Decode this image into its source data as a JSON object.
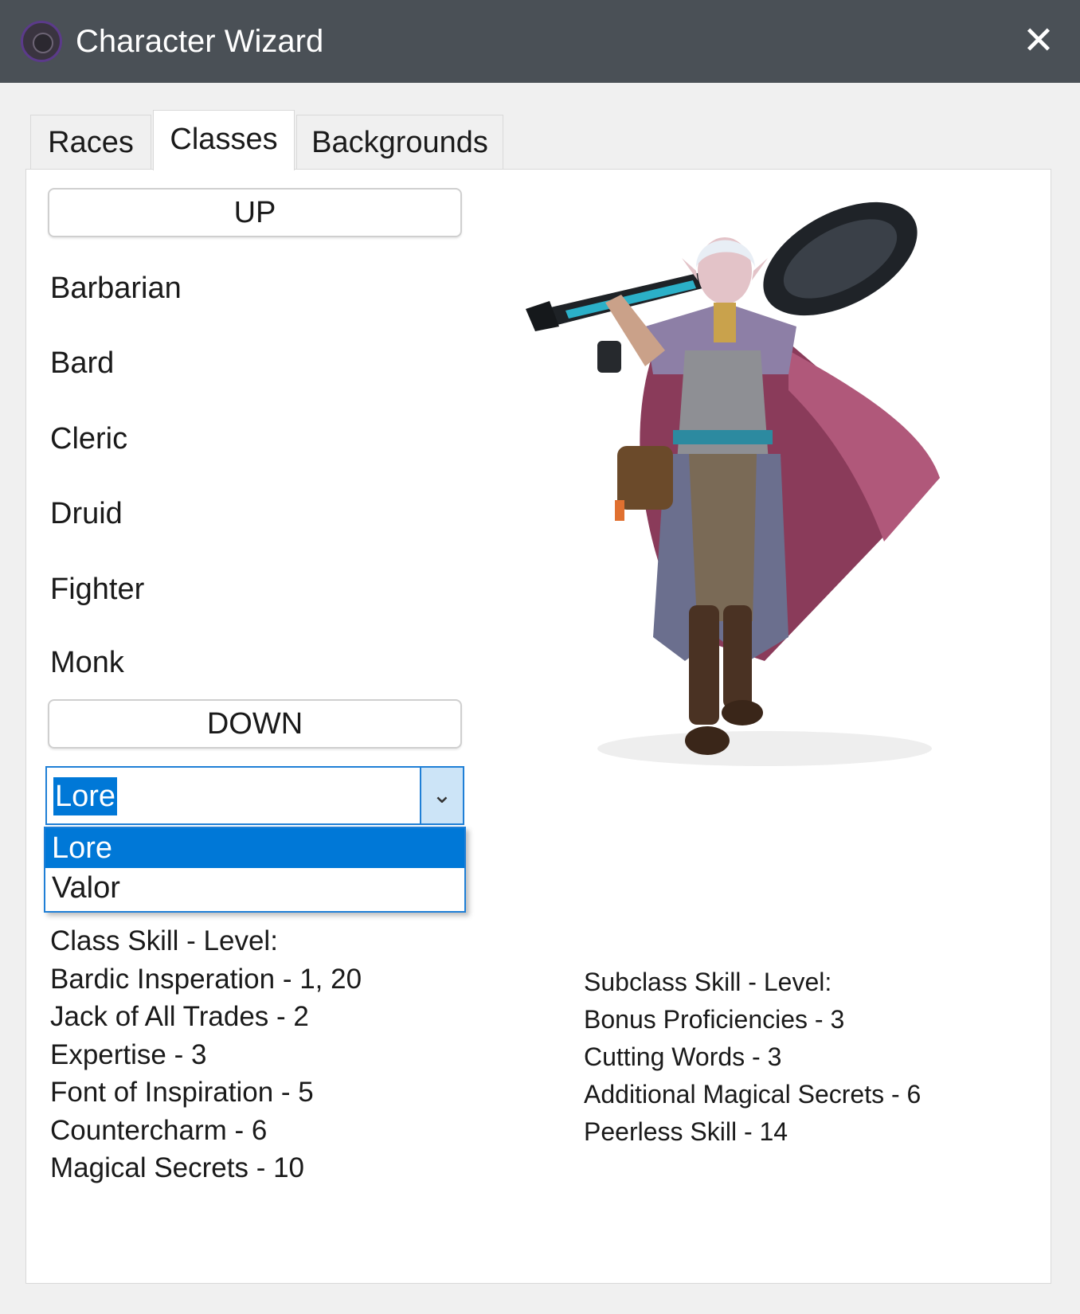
{
  "window": {
    "title": "Character Wizard",
    "close_label": "✕"
  },
  "tabs": [
    {
      "label": "Races"
    },
    {
      "label": "Classes"
    },
    {
      "label": "Backgrounds"
    }
  ],
  "classes_list": {
    "up_label": "UP",
    "down_label": "DOWN",
    "items": [
      "Barbarian",
      "Bard",
      "Cleric",
      "Druid",
      "Fighter",
      "Monk"
    ]
  },
  "subclass_combo": {
    "value": "Lore",
    "arrow": "⌄",
    "options": [
      "Lore",
      "Valor"
    ],
    "selected": "Lore"
  },
  "class_skills": {
    "header": "Class Skill - Level:",
    "items": [
      "Bardic Insperation - 1, 20",
      "Jack of All Trades - 2",
      "Expertise - 3",
      "Font of Inspiration - 5",
      "Countercharm  - 6",
      "Magical Secrets - 10"
    ]
  },
  "subclass_skills": {
    "header": "Subclass Skill - Level:",
    "items": [
      "Bonus Proficiencies - 3",
      "Cutting Words - 3",
      "Additional Magical Secrets - 6",
      "Peerless Skill - 14"
    ]
  },
  "colors": {
    "titlebar": "#4a5056",
    "accent": "#0078d7"
  }
}
